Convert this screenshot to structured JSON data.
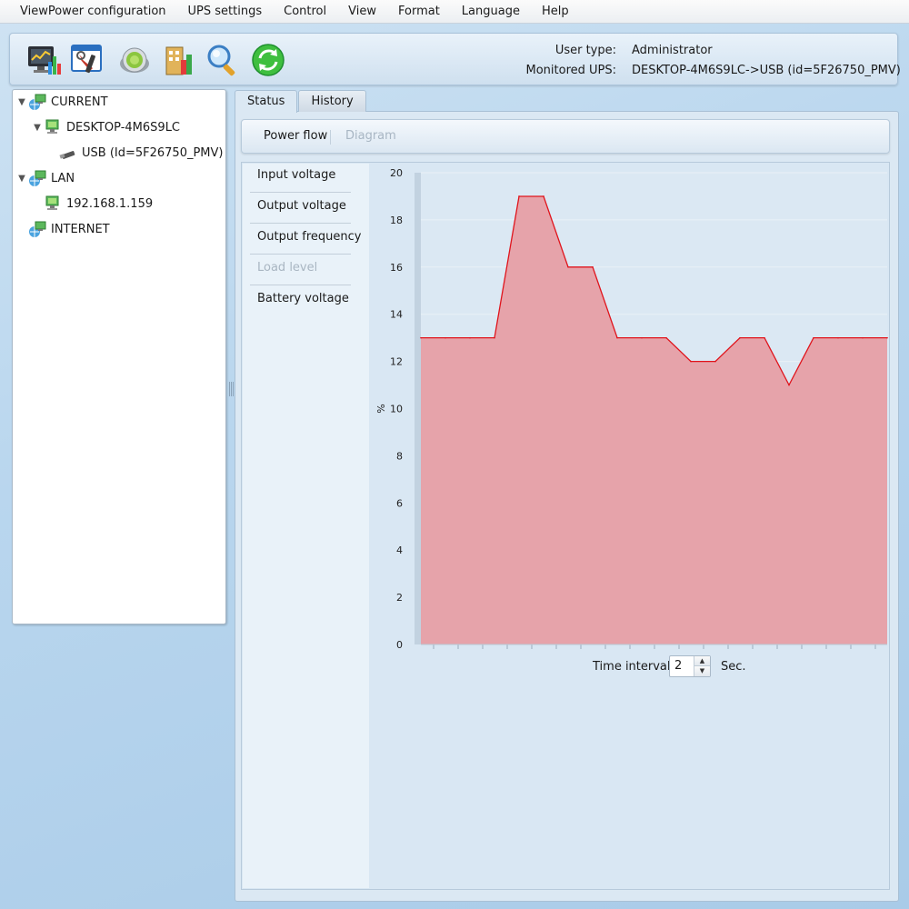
{
  "menu": [
    "ViewPower configuration",
    "UPS settings",
    "Control",
    "View",
    "Format",
    "Language",
    "Help"
  ],
  "toolbar": {
    "icons": [
      "monitor-chart-icon",
      "tools-settings-icon",
      "control-knob-icon",
      "building-report-icon",
      "search-magnifier-icon",
      "refresh-icon"
    ],
    "user_type_label": "User type:",
    "user_type_value": "Administrator",
    "monitored_label": "Monitored UPS:",
    "monitored_value": "DESKTOP-4M6S9LC->USB (id=5F26750_PMV)"
  },
  "tree": {
    "current": "CURRENT",
    "desktop": "DESKTOP-4M6S9LC",
    "usb": "USB (Id=5F26750_PMV)",
    "lan": "LAN",
    "lan_ip": "192.168.1.159",
    "internet": "INTERNET"
  },
  "tabs": [
    "Status",
    "History"
  ],
  "subtoolbar": {
    "power_flow": "Power flow",
    "diagram": "Diagram"
  },
  "params": [
    "Input voltage",
    "Output voltage",
    "Output frequency",
    "Load level",
    "Battery voltage"
  ],
  "interval": {
    "label": "Time interval",
    "value": "2",
    "unit": "Sec."
  },
  "colors": {
    "series_line": "#e0141c",
    "series_fill": "#e6a3aa",
    "plot_bg": "#dbe8f3"
  },
  "chart_data": {
    "type": "area",
    "ylabel": "%",
    "ylim": [
      0,
      20
    ],
    "yticks": [
      0,
      2,
      4,
      6,
      8,
      10,
      12,
      14,
      16,
      18,
      20
    ],
    "grid": true,
    "series": [
      {
        "values": [
          13,
          13,
          13,
          13,
          19,
          19,
          16,
          16,
          13,
          13,
          13,
          12,
          12,
          13,
          13,
          11,
          13,
          13,
          13,
          13
        ]
      }
    ]
  }
}
